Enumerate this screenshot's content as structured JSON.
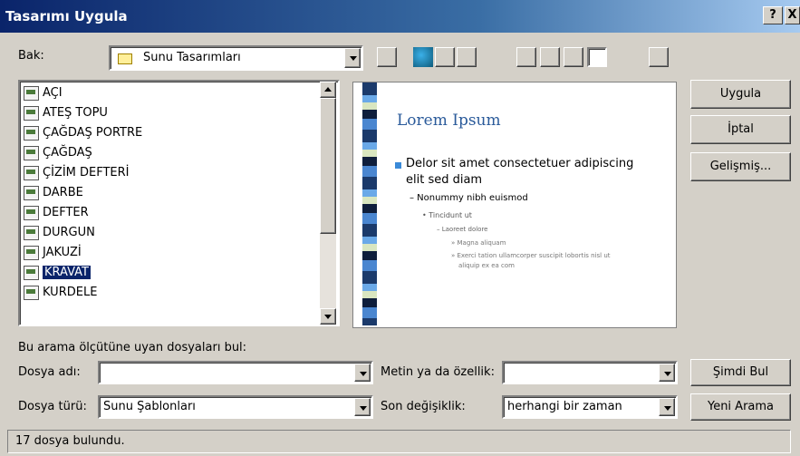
{
  "window": {
    "title": "Tasarımı Uygula",
    "help": "?",
    "close": "X"
  },
  "lookin": {
    "label": "Bak:",
    "value": "Sunu Tasarımları"
  },
  "toolbar_icons": [
    "up-folder-icon",
    "search-web-icon",
    "delete-icon",
    "new-folder-icon",
    "list-view-icon",
    "details-view-icon",
    "properties-view-icon",
    "preview-view-icon",
    "tools-icon"
  ],
  "files": [
    "AÇI",
    "ATEŞ TOPU",
    "ÇAĞDAŞ PORTRE",
    "ÇAĞDAŞ",
    "ÇİZİM DEFTERİ",
    "DARBE",
    "DEFTER",
    "DURGUN",
    "JAKUZİ",
    "KRAVAT",
    "KURDELE"
  ],
  "selected_file": "KRAVAT",
  "preview": {
    "title": "Lorem Ipsum",
    "bullet1": "Delor sit amet consectetuer adipiscing",
    "bullet1b": "elit sed diam",
    "bullet2": "– Nonummy nibh euismod",
    "bullet3": "• Tincidunt ut",
    "bullet4": "– Laoreet dolore",
    "bullet5": "» Magna aliquam",
    "bullet6": "» Exerci tation ullamcorper suscipit lobortis nisl ut",
    "bullet6b": "aliquip ex ea com"
  },
  "buttons": {
    "apply": "Uygula",
    "cancel": "İptal",
    "advanced": "Gelişmiş...",
    "find_now": "Şimdi Bul",
    "new_search": "Yeni Arama"
  },
  "search": {
    "heading": "Bu arama ölçütüne uyan dosyaları bul:",
    "filename_label": "Dosya adı:",
    "filename_value": "",
    "filetype_label": "Dosya türü:",
    "filetype_value": "Sunu Şablonları",
    "text_label": "Metin ya da özellik:",
    "text_value": "",
    "modified_label": "Son değişiklik:",
    "modified_value": "herhangi bir zaman"
  },
  "status": "17 dosya bulundu.",
  "colors": {
    "titlebar": "#0a246a",
    "selection": "#0a246a",
    "dialog": "#d4d0c8"
  }
}
